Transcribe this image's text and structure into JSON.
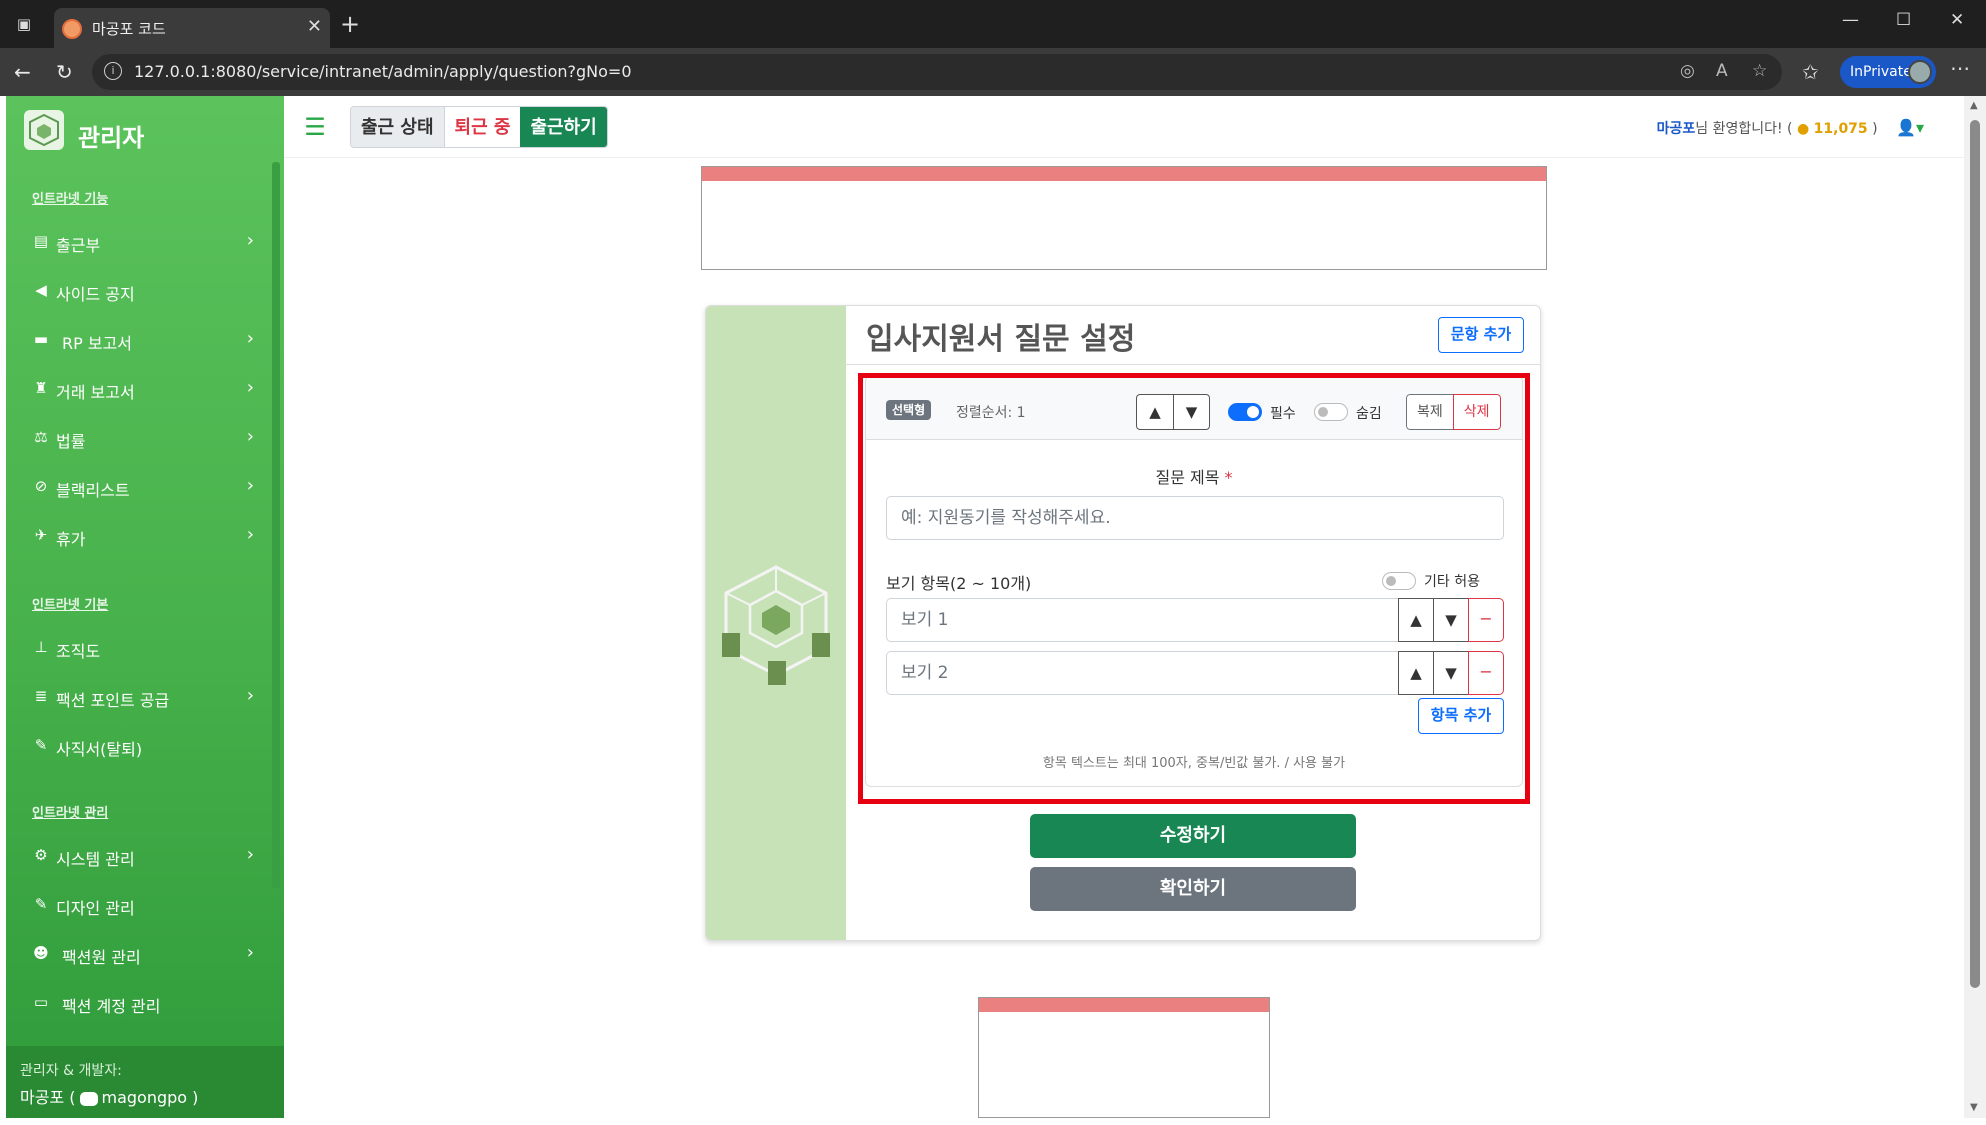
{
  "browser": {
    "tab_title": "마공포 코드",
    "url": "127.0.0.1:8080/service/intranet/admin/apply/question?gNo=0",
    "inprivate_label": "InPrivate"
  },
  "sidebar": {
    "brand": "관리자",
    "sections": [
      {
        "title": "인트라넷 기능",
        "items": [
          {
            "label": "출근부",
            "icon": "book-icon",
            "chevron": true
          },
          {
            "label": "사이드 공지",
            "icon": "megaphone-icon",
            "chevron": false
          },
          {
            "label": "RP 보고서",
            "icon": "gamepad-icon",
            "chevron": true
          },
          {
            "label": "거래 보고서",
            "icon": "money-bag-icon",
            "chevron": true
          },
          {
            "label": "법률",
            "icon": "scale-icon",
            "chevron": true
          },
          {
            "label": "블랙리스트",
            "icon": "ban-icon",
            "chevron": true
          },
          {
            "label": "휴가",
            "icon": "plane-icon",
            "chevron": true
          }
        ]
      },
      {
        "title": "인트라넷 기본",
        "items": [
          {
            "label": "조직도",
            "icon": "sitemap-icon",
            "chevron": false
          },
          {
            "label": "팩션 포인트 공급",
            "icon": "coins-icon",
            "chevron": true
          },
          {
            "label": "사직서(탈퇴)",
            "icon": "feather-icon",
            "chevron": false
          }
        ]
      },
      {
        "title": "인트라넷 관리",
        "items": [
          {
            "label": "시스템 관리",
            "icon": "gear-icon",
            "chevron": true
          },
          {
            "label": "디자인 관리",
            "icon": "brush-icon",
            "chevron": false
          },
          {
            "label": "팩션원 관리",
            "icon": "user-gear-icon",
            "chevron": true
          },
          {
            "label": "팩션 계정 관리",
            "icon": "id-card-icon",
            "chevron": false
          }
        ]
      }
    ],
    "footer": {
      "line1": "관리자 & 개발자:",
      "name": "마공포 (",
      "handle": "magongpo )"
    }
  },
  "topbar": {
    "status_label": "출근 상태",
    "state_label": "퇴근 중",
    "checkin_label": "출근하기",
    "welcome_name": "마공포",
    "welcome_text": "님 환영합니다! (",
    "coins": "11,075",
    "welcome_close": " )"
  },
  "card": {
    "title": "입사지원서 질문 설정",
    "add_question": "문항 추가",
    "question": {
      "type_badge": "선택형",
      "order_label": "정렬순서: 1",
      "required_label": "필수",
      "required_on": true,
      "hidden_label": "숨김",
      "hidden_on": false,
      "copy_label": "복제",
      "delete_label": "삭제",
      "title_label": "질문 제목",
      "required_mark": "*",
      "title_placeholder": "예: 지원동기를 작성해주세요.",
      "options_label": "보기 항목(2 ~ 10개)",
      "etc_label": "기타 허용",
      "etc_on": false,
      "options": [
        {
          "placeholder": "보기 1"
        },
        {
          "placeholder": "보기 2"
        }
      ],
      "add_item": "항목 추가",
      "hint": "항목 텍스트는 최대 100자, 중복/빈값 불가. / 사용 불가"
    },
    "edit_button": "수정하기",
    "confirm_button": "확인하기"
  },
  "colors": {
    "sidebar_green": "#46b04a",
    "primary": "#0d6efd",
    "success": "#198754",
    "danger": "#dc3545",
    "highlight": "#e60012"
  }
}
